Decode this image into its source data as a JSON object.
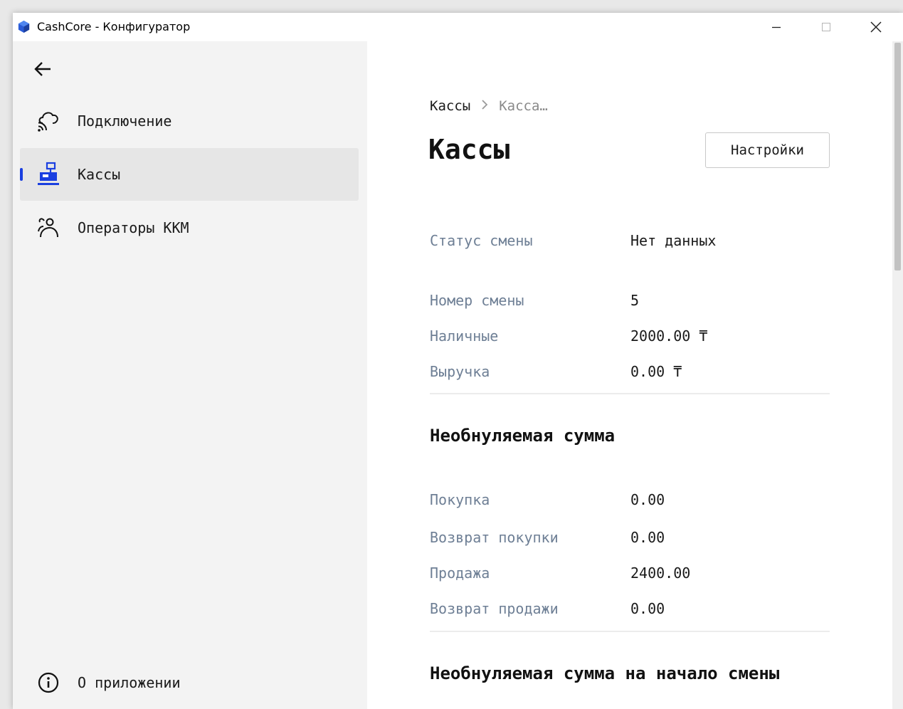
{
  "window": {
    "title": "CashCore - Конфигуратор"
  },
  "sidebar": {
    "items": [
      {
        "label": "Подключение",
        "icon": "cloud-connection-icon",
        "active": false
      },
      {
        "label": "Кассы",
        "icon": "cash-register-icon",
        "active": true
      },
      {
        "label": "Операторы ККМ",
        "icon": "operators-icon",
        "active": false
      }
    ],
    "about": {
      "label": "О приложении",
      "icon": "info-icon"
    }
  },
  "main": {
    "breadcrumb": {
      "root": "Кассы",
      "current": "Касса…"
    },
    "title": "Кассы",
    "settings_label": "Настройки",
    "status": {
      "label": "Статус смены",
      "value": "Нет данных"
    },
    "shift": [
      {
        "label": "Номер смены",
        "value": "5"
      },
      {
        "label": "Наличные",
        "value": "2000.00 ₸"
      },
      {
        "label": "Выручка",
        "value": "0.00 ₸"
      }
    ],
    "non_zero_sum": {
      "title": "Необнуляемая сумма",
      "rows": [
        {
          "label": "Покупка",
          "value": "0.00"
        },
        {
          "label": "Возврат покупки",
          "value": "0.00"
        },
        {
          "label": "Продажа",
          "value": "2400.00"
        },
        {
          "label": "Возврат продажи",
          "value": "0.00"
        }
      ]
    },
    "non_zero_sum_start": {
      "title": "Необнуляемая сумма на начало смены"
    }
  },
  "colors": {
    "accent": "#1a3fe0",
    "label": "#6e7f95",
    "sidebar_bg": "#f3f3f3"
  }
}
